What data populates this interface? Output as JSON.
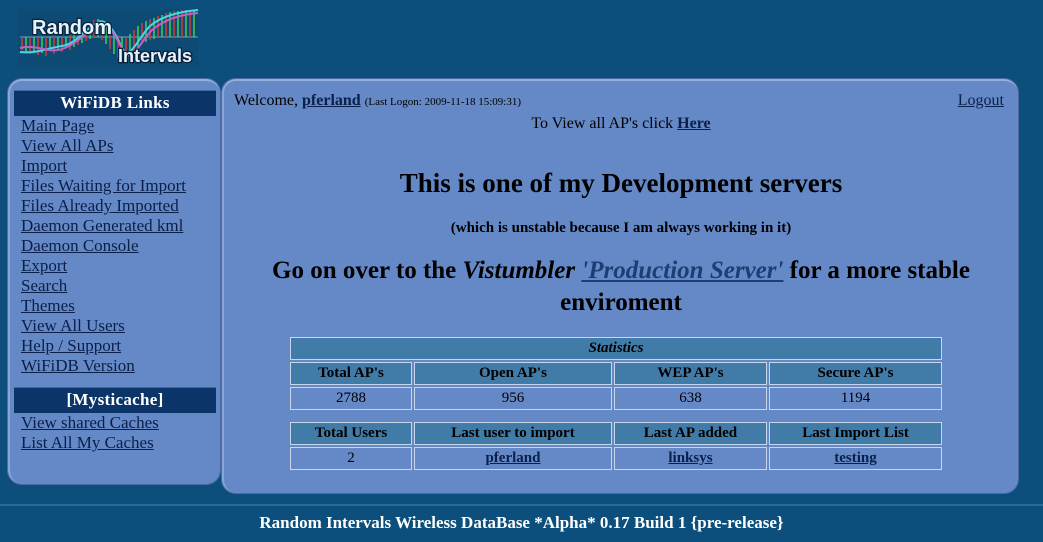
{
  "site": {
    "logo_text_1": "Random",
    "logo_text_2": "Intervals",
    "footer": "Random Intervals Wireless DataBase *Alpha* 0.17 Build 1 {pre-release}"
  },
  "colors": {
    "page_background": "#0d4f7c",
    "panel": "#6589c6",
    "panel_header": "#0b3568",
    "table_header": "#417ba8",
    "link": "#0a1f4a",
    "footer_text": "#ffffff"
  },
  "sidebar": {
    "sections": [
      {
        "title": "WiFiDB Links",
        "items": [
          {
            "label": "Main Page"
          },
          {
            "label": "View All APs"
          },
          {
            "label": "Import"
          },
          {
            "label": "Files Waiting for Import"
          },
          {
            "label": "Files Already Imported"
          },
          {
            "label": "Daemon Generated kml"
          },
          {
            "label": "Daemon Console"
          },
          {
            "label": "Export"
          },
          {
            "label": "Search"
          },
          {
            "label": "Themes"
          },
          {
            "label": "View All Users"
          },
          {
            "label": "Help / Support"
          },
          {
            "label": "WiFiDB Version"
          }
        ]
      },
      {
        "title": "[Mysticache]",
        "items": [
          {
            "label": "View shared Caches"
          },
          {
            "label": "List All My Caches"
          }
        ]
      }
    ]
  },
  "main": {
    "welcome_prefix": "Welcome,",
    "username": "pferland",
    "last_logon": "(Last Logon: 2009-11-18 15:09:31)",
    "logout_label": "Logout",
    "viewall_prefix": "To View all AP's click",
    "viewall_link": "Here",
    "heading_dev": "This is one of my Development servers",
    "heading_sub": "(which is unstable because I am always working in it)",
    "prod_before": "Go on over to the",
    "prod_italic": "Vistumbler",
    "prod_link": "'Production Server'",
    "prod_after": "for a more stable enviroment"
  },
  "stats_table": {
    "title": "Statistics",
    "block1": {
      "headers": [
        "Total AP's",
        "Open AP's",
        "WEP AP's",
        "Secure AP's"
      ],
      "values": [
        "2788",
        "956",
        "638",
        "1194"
      ]
    },
    "block2": {
      "headers": [
        "Total Users",
        "Last user to import",
        "Last AP added",
        "Last Import List"
      ],
      "values": [
        "2",
        "pferland",
        "linksys",
        "testing"
      ],
      "value_is_link": [
        false,
        true,
        true,
        true
      ]
    }
  }
}
